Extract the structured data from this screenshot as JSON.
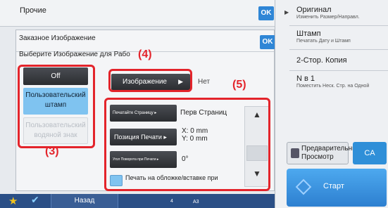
{
  "base": {
    "title": "Прочие",
    "ok_label": "OK"
  },
  "modal": {
    "title": "Заказное Изображение",
    "subtitle": "Выберите Изображение для Рабо",
    "ok_label": "OK",
    "options": {
      "off": "Off",
      "custom_stamp": "Пользовательский штамп",
      "custom_watermark": "Пользовательский водяной знак"
    },
    "image_button": "Изображение",
    "image_partial": "Нет",
    "settings": {
      "print_page_label": "Печатайте Страницу",
      "print_page_value": "Перв Страниц",
      "stamp_position_label": "Позиция Печати",
      "x_value": "X: 0 mm",
      "y_value": "Y: 0 mm",
      "rotation_label": "Угол Поворота при Печати",
      "rotation_value": "0°",
      "cover_checkbox_label": "Печать на обложке/вставке при"
    }
  },
  "callouts": {
    "c3": "(3)",
    "c4": "(4)",
    "c5": "(5)"
  },
  "right_panel": {
    "items": [
      {
        "title": "Оригинал",
        "sub": "Изменить Размер/Направл."
      },
      {
        "title": "Штамп",
        "sub": "Печатать Дату и Штамп"
      },
      {
        "title": "2-Стор. Копия",
        "sub": ""
      },
      {
        "title": "N в 1",
        "sub": "Поместить Неск. Стр. на Одной"
      }
    ],
    "preview_label": "Предварительный Просмотр",
    "ca_label": "CA",
    "start_label": "Старт"
  },
  "bottom_bar": {
    "back_label": "Назад",
    "paper_count": "4",
    "paper_size": "A3"
  },
  "colors": {
    "accent_blue": "#2f86d6",
    "callout_red": "#e3242b",
    "selected_option": "#7fc3f0",
    "bottom_bar": "#2b4f86"
  }
}
